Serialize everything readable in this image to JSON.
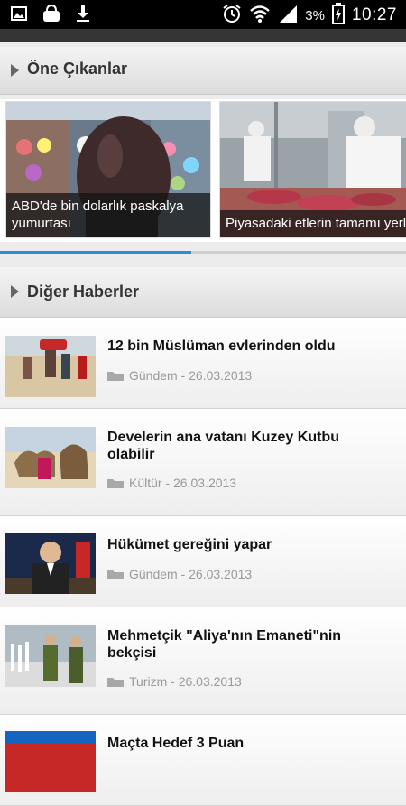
{
  "status_bar": {
    "battery": "3%",
    "time": "10:27",
    "icons_left": [
      "image-icon",
      "shopping-bag-icon",
      "download-icon"
    ],
    "icons_right": [
      "alarm-icon",
      "wifi-icon",
      "signal-icon",
      "battery-icon"
    ]
  },
  "sections": {
    "featured_title": "Öne Çıkanlar",
    "other_title": "Diğer Haberler"
  },
  "featured": [
    {
      "caption": "ABD'de bin dolarlık paskalya yumurtası"
    },
    {
      "caption": "Piyasadaki etlerin tamamı yerli"
    }
  ],
  "carousel_progress": 0.47,
  "news": [
    {
      "title": "12 bin Müslüman evlerinden oldu",
      "category": "Gündem",
      "date": "26.03.2013",
      "meta": "Gündem - 26.03.2013"
    },
    {
      "title": "Develerin ana vatanı Kuzey Kutbu olabilir",
      "category": "Kültür",
      "date": "26.03.2013",
      "meta": "Kültür - 26.03.2013"
    },
    {
      "title": "Hükümet gereğini yapar",
      "category": "Gündem",
      "date": "26.03.2013",
      "meta": "Gündem - 26.03.2013"
    },
    {
      "title": "Mehmetçik \"Aliya'nın Emaneti\"nin bekçisi",
      "category": "Turizm",
      "date": "26.03.2013",
      "meta": "Turizm - 26.03.2013"
    },
    {
      "title": "Maçta Hedef 3 Puan",
      "category": "",
      "date": "",
      "meta": ""
    }
  ],
  "colors": {
    "accent": "#2b8ed8",
    "status_bar": "#000000",
    "header_text": "#333333",
    "meta_text": "#9a9a9a"
  }
}
